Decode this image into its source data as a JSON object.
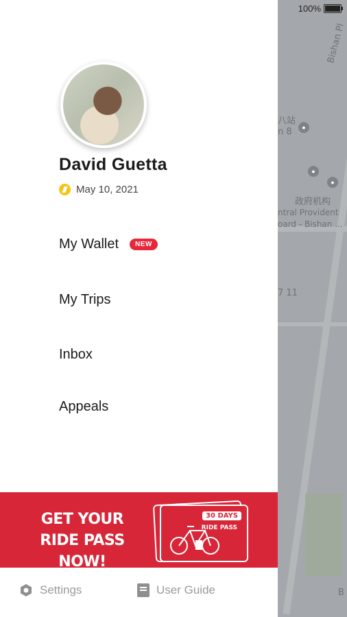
{
  "status_bar": {
    "battery": "100%"
  },
  "map": {
    "labels": [
      "Bishan Pl",
      "八站",
      "n 8",
      "政府机构",
      "ntral Provident",
      "oard - Bishan ...",
      "7 11",
      "B"
    ]
  },
  "profile": {
    "name": "David Guetta",
    "date": "May 10, 2021"
  },
  "menu": {
    "wallet": {
      "label": "My Wallet",
      "badge": "NEW"
    },
    "trips": "My Trips",
    "inbox": "Inbox",
    "appeals": "Appeals"
  },
  "banner": {
    "line1": "GET YOUR",
    "line2": "RIDE PASS NOW!",
    "card_title": "30 DAYS",
    "card_sub": "RIDE PASS"
  },
  "footer": {
    "settings": "Settings",
    "user_guide": "User Guide"
  },
  "colors": {
    "brand_red": "#d72638",
    "badge_red": "#e8273a",
    "date_icon": "#f4c514"
  },
  "icons": {
    "settings": "gear-icon",
    "user_guide": "book-icon",
    "date": "clock-icon"
  }
}
